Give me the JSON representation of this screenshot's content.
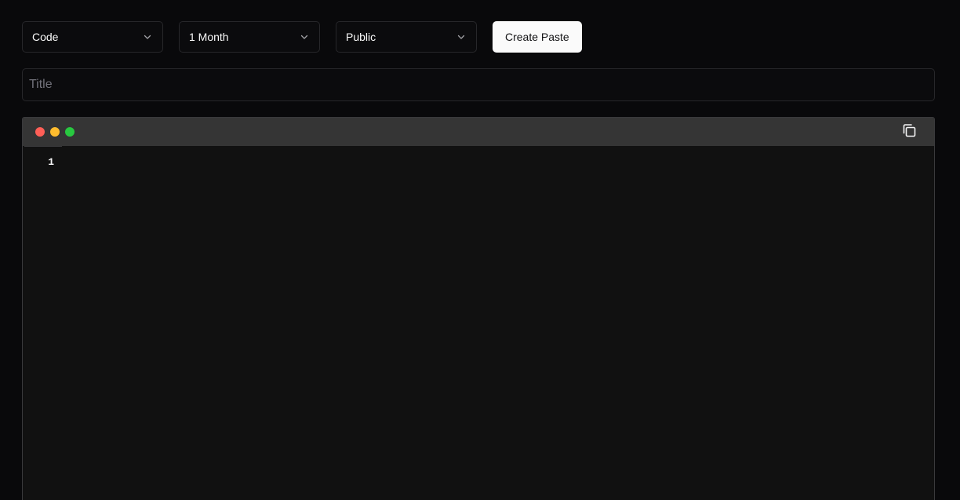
{
  "toolbar": {
    "syntax_select": {
      "value": "Code"
    },
    "expiration_select": {
      "value": "1 Month"
    },
    "visibility_select": {
      "value": "Public"
    },
    "create_label": "Create Paste"
  },
  "title_input": {
    "placeholder": "Title",
    "value": ""
  },
  "editor": {
    "line_numbers": [
      "1"
    ],
    "content": "",
    "window_controls": {
      "close_color": "#ff5f57",
      "minimize_color": "#febc2e",
      "maximize_color": "#28c840"
    },
    "copy_icon": "copy-icon"
  },
  "colors": {
    "background": "#09090b",
    "surface": "#0b0b0d",
    "border": "#27272a",
    "editor_header": "#353535",
    "editor_body": "#111111",
    "button_bg": "#fafafa",
    "button_text": "#111113",
    "placeholder": "#71717a"
  }
}
